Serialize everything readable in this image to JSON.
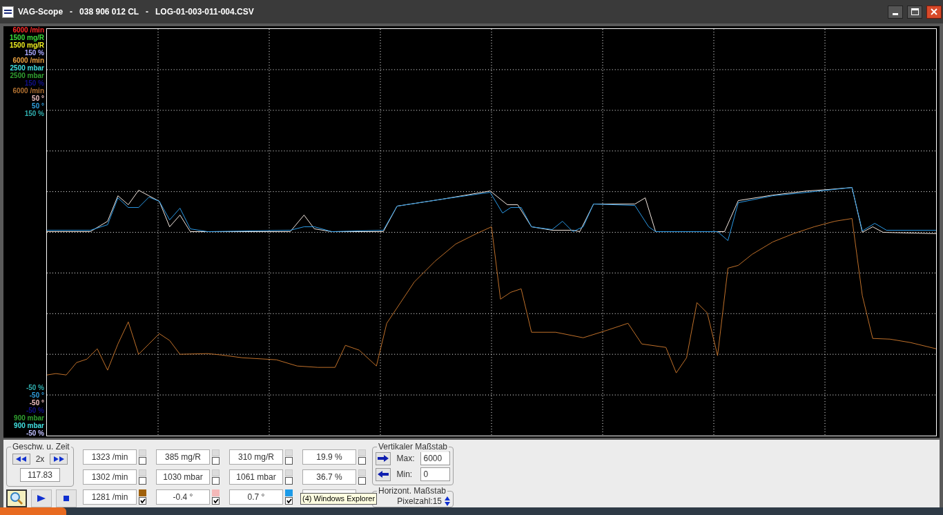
{
  "window": {
    "title": "VAG-Scope   -   038 906 012 CL   -   LOG-01-003-011-004.CSV"
  },
  "scale_labels_top": [
    {
      "text": "6000 /min",
      "color": "#ff2a2a"
    },
    {
      "text": "1500 mg/R",
      "color": "#3cdc3c"
    },
    {
      "text": "1500 mg/R",
      "color": "#f0f020"
    },
    {
      "text": "150 %",
      "color": "#a8a8ff"
    },
    {
      "text": "6000 /min",
      "color": "#e8a040"
    },
    {
      "text": "2500 mbar",
      "color": "#40e0e0"
    },
    {
      "text": "2500 mbar",
      "color": "#30a030"
    },
    {
      "text": "150 %",
      "color": "#10108a"
    },
    {
      "text": "6000 /min",
      "color": "#b07030"
    },
    {
      "text": "50 °",
      "color": "#f0c0c0"
    },
    {
      "text": "50 °",
      "color": "#30a0e0"
    },
    {
      "text": "150 %",
      "color": "#30b0b0"
    }
  ],
  "scale_labels_bottom": [
    {
      "text": "-50 %",
      "color": "#30b0b0"
    },
    {
      "text": "-50 °",
      "color": "#30a0e0"
    },
    {
      "text": "-50 °",
      "color": "#f0c0c0"
    },
    {
      "text": "-50 %",
      "color": "#10108a"
    },
    {
      "text": "900 mbar",
      "color": "#30a030"
    },
    {
      "text": "900 mbar",
      "color": "#40e0e0"
    },
    {
      "text": "-50 %",
      "color": "#c0c0ff"
    }
  ],
  "speed_time": {
    "title": "Geschw. u. Zeit",
    "speed": "2x",
    "time": "117.83"
  },
  "readings": [
    {
      "value": "1323 /min",
      "checked": false
    },
    {
      "value": "385 mg/R",
      "checked": false
    },
    {
      "value": "310 mg/R",
      "checked": false
    },
    {
      "value": "19.9 %",
      "checked": false
    },
    {
      "value": "1302 /min",
      "checked": false
    },
    {
      "value": "1030 mbar",
      "checked": false
    },
    {
      "value": "1061 mbar",
      "checked": false
    },
    {
      "value": "36.7 %",
      "checked": false
    },
    {
      "value": "1281 /min",
      "checked": true,
      "color": "#a0600a"
    },
    {
      "value": "-0.4 °",
      "checked": true,
      "color": "#f4b8b8"
    },
    {
      "value": "0.7 °",
      "checked": true,
      "color": "#1e9be8"
    }
  ],
  "vertical_scale": {
    "title": "Vertikaler Maßstab",
    "max_label": "Max:",
    "max": "6000",
    "min_label": "Min:",
    "min": "0"
  },
  "horizontal_scale": {
    "title": "Horizont. Maßstab",
    "pixel_count": "Pixelzahl:15"
  },
  "tooltip": "(4) Windows Explorer"
}
